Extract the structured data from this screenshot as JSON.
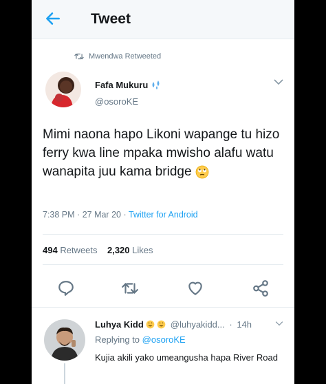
{
  "header": {
    "title": "Tweet"
  },
  "retweet": {
    "label": "Mwendwa Retweeted"
  },
  "tweet": {
    "author": "Fafa Mukuru",
    "handle": "@osoroKE",
    "text": "Mimi naona hapo Likoni wapange tu hizo ferry kwa line mpaka mwisho alafu watu wanapita juu kama bridge",
    "time": "7:38 PM",
    "date": "27 Mar 20",
    "source": "Twitter for Android",
    "retweets_count": "494",
    "retweets_label": "Retweets",
    "likes_count": "2,320",
    "likes_label": "Likes"
  },
  "reply": {
    "author": "Luhya Kidd",
    "handle": "@luhyakidd...",
    "time": "14h",
    "replying_prefix": "Replying to",
    "replying_to": "@osoroKE",
    "text": "Kujia akili yako umeangusha hapa River Road"
  },
  "colors": {
    "accent": "#1da1f2",
    "muted": "#657786",
    "text": "#14171a"
  }
}
